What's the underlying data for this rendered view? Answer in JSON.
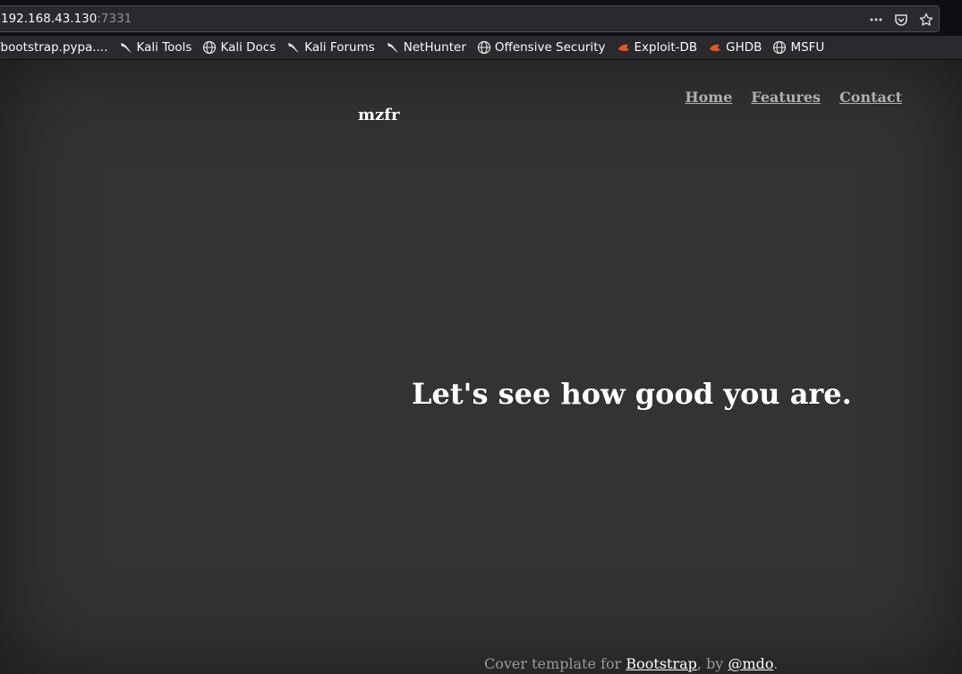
{
  "browser": {
    "url_host": "192.168.43.130",
    "url_port": ":7331",
    "actions": [
      {
        "icon": "more-actions-icon",
        "glyph": "•••"
      },
      {
        "icon": "pocket-icon",
        "glyph": ""
      },
      {
        "icon": "star-bookmark-icon",
        "glyph": "☆"
      }
    ],
    "bookmarks": [
      {
        "label": "/bootstrap.pypa....",
        "icon": "none"
      },
      {
        "label": "Kali Tools",
        "icon": "kali-dragon-icon"
      },
      {
        "label": "Kali Docs",
        "icon": "globe-icon"
      },
      {
        "label": "Kali Forums",
        "icon": "kali-dragon-icon"
      },
      {
        "label": "NetHunter",
        "icon": "kali-dragon-icon"
      },
      {
        "label": "Offensive Security",
        "icon": "globe-icon"
      },
      {
        "label": "Exploit-DB",
        "icon": "exploit-db-icon"
      },
      {
        "label": "GHDB",
        "icon": "exploit-db-icon"
      },
      {
        "label": "MSFU",
        "icon": "globe-icon"
      }
    ]
  },
  "page": {
    "brand": "mzfr",
    "nav": [
      {
        "label": "Home"
      },
      {
        "label": "Features"
      },
      {
        "label": "Contact"
      }
    ],
    "hero_heading": "Let's see how good you are.",
    "footer": {
      "prefix": "Cover template for ",
      "link1": "Bootstrap",
      "middle": ", by ",
      "link2": "@mdo",
      "suffix": "."
    }
  },
  "colors": {
    "page_bg": "#333333",
    "chrome_bg": "#0f0f13",
    "toolbar_bg": "#2a2a2e",
    "nav_link": "#b0b0b0",
    "exploit_db_accent": "#e8561c"
  }
}
